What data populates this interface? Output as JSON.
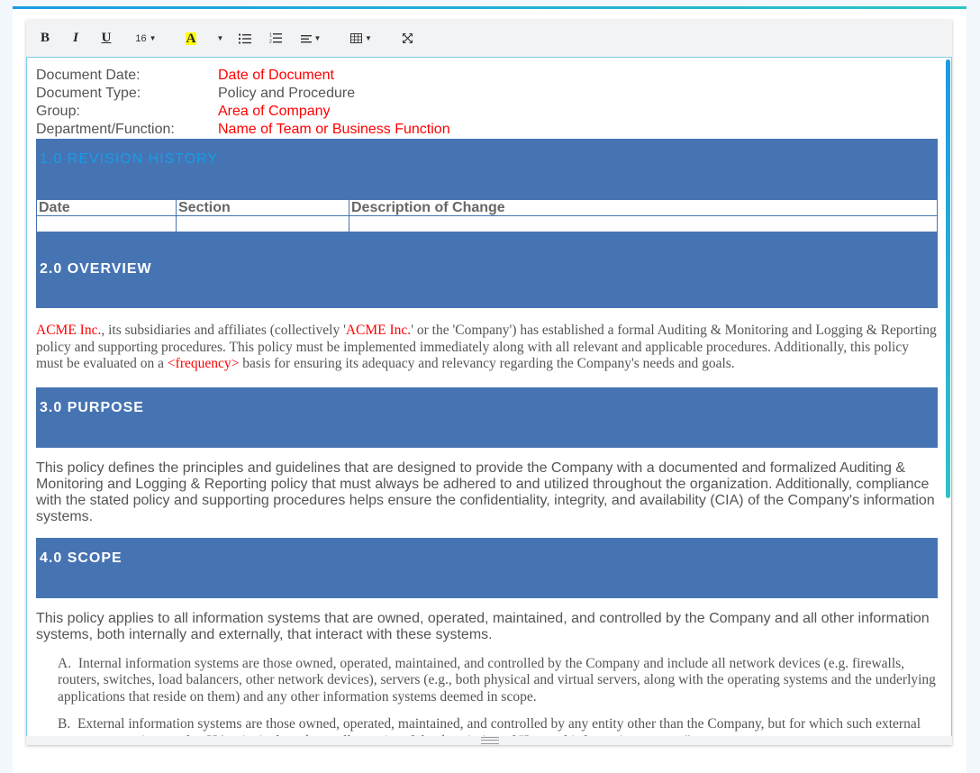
{
  "toolbar": {
    "bold": "B",
    "italic": "I",
    "underline": "U",
    "font_size": "16",
    "highlight": "A",
    "icons": [
      "bold-icon",
      "italic-icon",
      "underline-icon",
      "font-size-dropdown",
      "highlight-color-icon",
      "color-dropdown-caret",
      "bulleted-list-icon",
      "numbered-list-icon",
      "align-dropdown-icon",
      "table-dropdown-icon",
      "fullscreen-icon"
    ]
  },
  "colors": {
    "accent": "#1a9be6",
    "accent_end": "#2bc4c8",
    "section_bar": "#4674b3",
    "placeholder_red": "#ff0000",
    "body_text": "#555555"
  },
  "meta": [
    {
      "label": "Document Date:",
      "value": "Date of Document",
      "placeholder": true
    },
    {
      "label": "Document Type:",
      "value": "Policy and Procedure",
      "placeholder": false
    },
    {
      "label": "Group:",
      "value": "Area of Company",
      "placeholder": true
    },
    {
      "label": "Department/Function:",
      "value": "Name of Team or Business Function",
      "placeholder": true
    }
  ],
  "sections": {
    "revision": {
      "title": "1.0 REVISION HISTORY",
      "columns": [
        "Date",
        "Section",
        "Description of Change"
      ],
      "rows": [
        [
          "",
          "",
          ""
        ]
      ]
    },
    "overview": {
      "title": "2.0 OVERVIEW",
      "parts": [
        {
          "text": "ACME Inc.",
          "red": true
        },
        {
          "text": ", its subsidiaries and affiliates (collectively '",
          "red": false
        },
        {
          "text": "ACME Inc.",
          "red": true
        },
        {
          "text": "' or the 'Company') has established a formal Auditing & Monitoring and Logging & Reporting policy and supporting procedures. This policy must be implemented immediately along with all relevant and applicable procedures. Additionally, this policy must be evaluated on a ",
          "red": false
        },
        {
          "text": "<frequency>",
          "red": true
        },
        {
          "text": " basis for ensuring its adequacy and relevancy regarding the Company's needs and goals.",
          "red": false
        }
      ]
    },
    "purpose": {
      "title": "3.0 PURPOSE",
      "text": "This policy defines the principles and guidelines that are designed to provide the Company with a documented and formalized Auditing & Monitoring and Logging & Reporting policy that must always be adhered to and utilized throughout the organization. Additionally, compliance with the stated policy and supporting procedures helps ensure the confidentiality, integrity, and availability (CIA) of the Company's information systems."
    },
    "scope": {
      "title": "4.0 SCOPE",
      "text": "This policy applies to all information systems that are owned, operated, maintained, and controlled by the Company and all other information systems, both internally and externally, that interact with these systems.",
      "items": [
        {
          "marker": "A.",
          "text": "Internal information systems are those owned, operated, maintained, and controlled by the Company and include all network devices (e.g. firewalls, routers, switches, load balancers, other network devices), servers (e.g., both physical and virtual servers, along with the operating systems and the underlying applications that reside on them) and any other information systems deemed in scope."
        },
        {
          "marker": "B.",
          "text": "External information systems are those owned, operated, maintained, and controlled by any entity other than the Company, but for which such external resources may impact the CIA principals and overall security of the description of \"Internal information systems\"."
        }
      ]
    }
  }
}
